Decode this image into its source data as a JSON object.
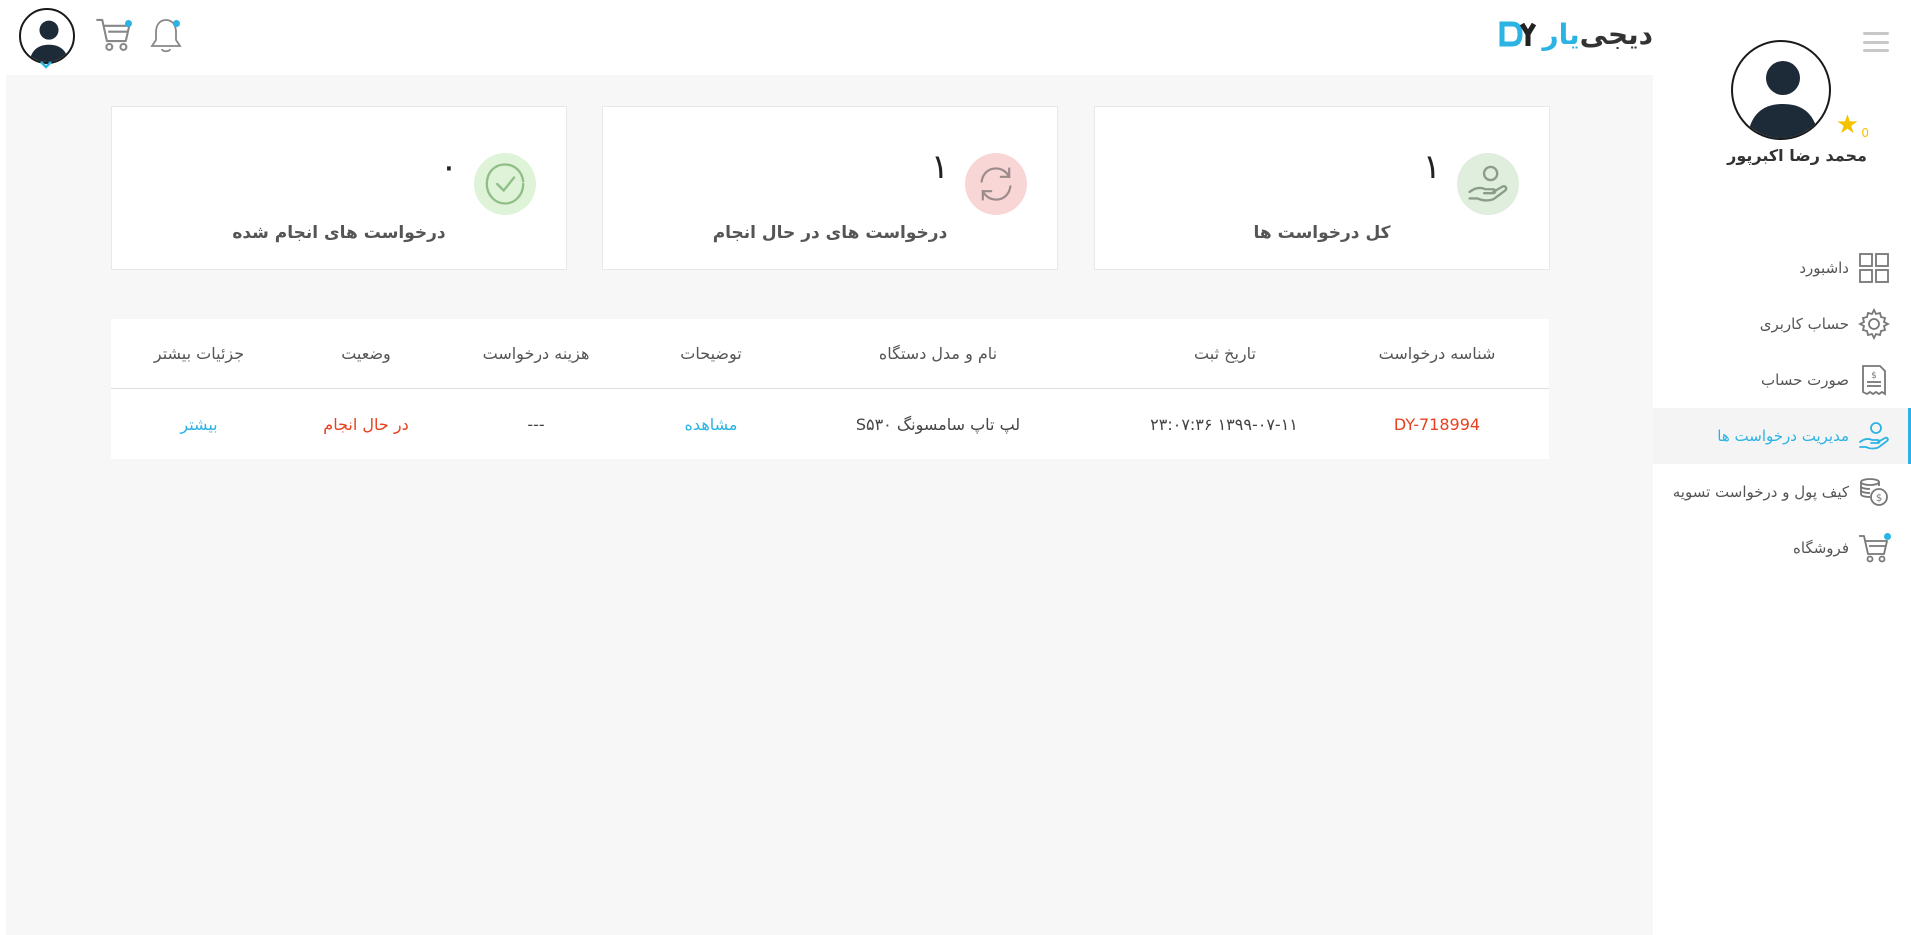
{
  "header": {
    "logo_part1": "دیجی",
    "logo_part2": "یار",
    "logo_mark": "DY"
  },
  "sidebar": {
    "user_name": "محمد رضا اکبرپور",
    "star_count": "0",
    "items": [
      {
        "label": "داشبورد",
        "icon": "dashboard-grid-icon",
        "active": false
      },
      {
        "label": "حساب کاربری",
        "icon": "gear-icon",
        "active": false
      },
      {
        "label": "صورت حساب",
        "icon": "invoice-icon",
        "active": false
      },
      {
        "label": "مدیریت درخواست ها",
        "icon": "hand-icon",
        "active": true
      },
      {
        "label": "کیف پول و درخواست تسویه",
        "icon": "coins-icon",
        "active": false
      },
      {
        "label": "فروشگاه",
        "icon": "cart-icon",
        "active": false
      }
    ]
  },
  "cards": [
    {
      "label": "کل درخواست ها",
      "count": "۱",
      "icon": "hand-icon",
      "color": "#dfeedd"
    },
    {
      "label": "درخواست های در حال انجام",
      "count": "۱",
      "icon": "sync-icon",
      "color": "#f8d6d6"
    },
    {
      "label": "درخواست های انجام شده",
      "count": "۰",
      "icon": "check-circle-icon",
      "color": "#dff3d8"
    }
  ],
  "table": {
    "headers": [
      "شناسه درخواست",
      "تاریخ ثبت",
      "نام و مدل دستگاه",
      "توضیحات",
      "هزینه درخواست",
      "وضعیت",
      "جزئیات بیشتر"
    ],
    "rows": [
      {
        "id": "DY-718994",
        "date": "۱۳۹۹-۰۷-۱۱ ۲۳:۰۷:۳۶",
        "device": "لپ تاپ سامسونگ S۵۳۰",
        "description": "مشاهده",
        "cost": "---",
        "status": "در حال انجام",
        "details": "بیشتر"
      }
    ]
  },
  "colors": {
    "accent": "#2bb3e3",
    "danger": "#e8411f",
    "star": "#f3c300"
  }
}
